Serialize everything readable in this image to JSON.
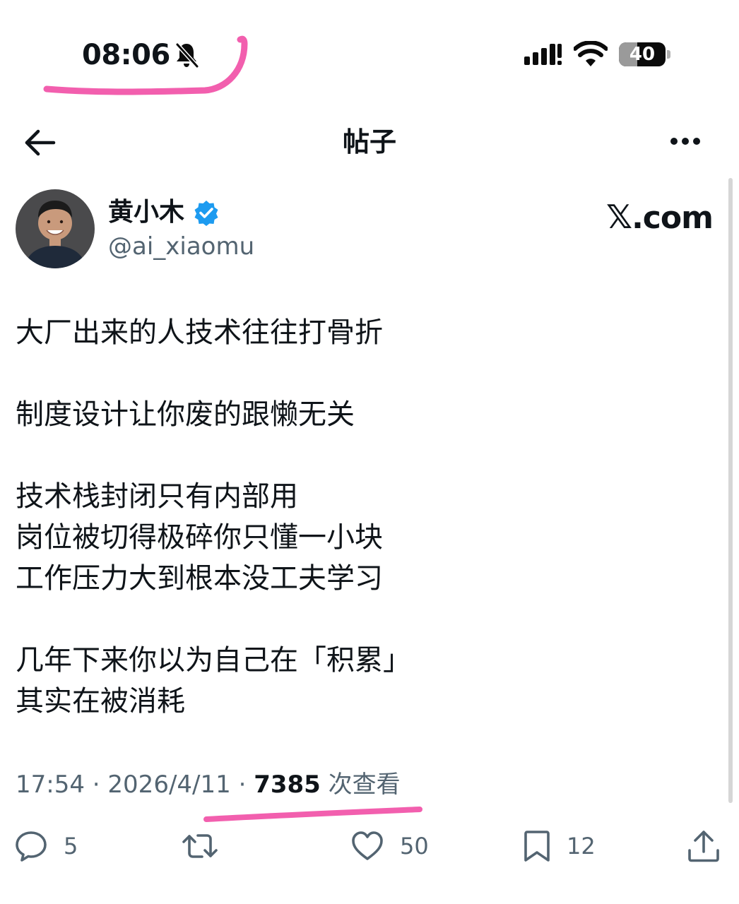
{
  "status_bar": {
    "time": "08:06",
    "battery_text": "40",
    "battery_level": 0.4,
    "icons": [
      "bell-slash-icon",
      "signal-icon",
      "wifi-icon",
      "battery-icon"
    ]
  },
  "header": {
    "title": "帖子",
    "back_icon": "arrow-left-icon",
    "more_icon": "more-horizontal-icon"
  },
  "author": {
    "name": "黄小木",
    "handle": "@ai_xiaomu",
    "verified": true,
    "verified_color": "#1d9bf0"
  },
  "watermark": {
    "x_mark": "𝕏",
    "suffix": ".com"
  },
  "post": {
    "lines": [
      "大厂出来的人技术往往打骨折",
      "制度设计让你废的跟懒无关",
      "技术栈封闭只有内部用",
      "岗位被切得极碎你只懂一小块",
      "工作压力大到根本没工夫学习",
      "几年下来你以为自己在「积累」",
      "其实在被消耗"
    ]
  },
  "meta": {
    "time": "17:54",
    "separator": " · ",
    "date": "2026/4/11",
    "views": "7385",
    "views_label": " 次查看"
  },
  "actions": {
    "replies": "5",
    "retweets": "",
    "likes": "50",
    "bookmarks": "12"
  },
  "colors": {
    "highlight": "#f25fae",
    "secondary_text": "#536471",
    "primary_text": "#0f1419"
  }
}
